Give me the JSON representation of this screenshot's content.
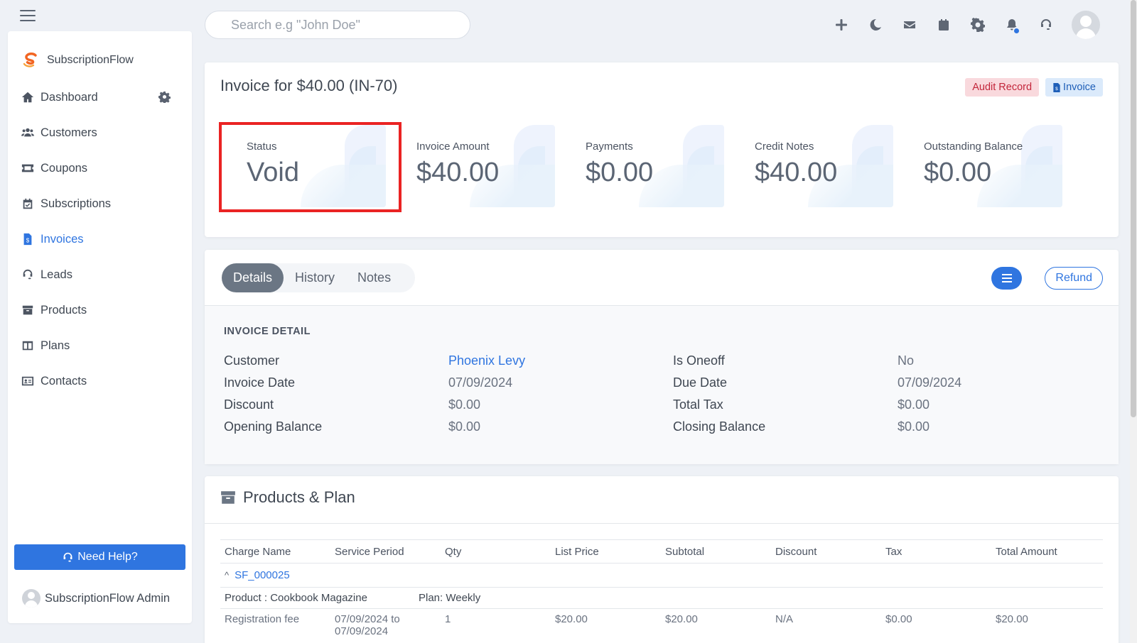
{
  "search": {
    "placeholder": "Search e.g \"John Doe\""
  },
  "top_icons": [
    "plus-icon",
    "moon-icon",
    "envelope-icon",
    "calendar-icon",
    "gear-icon",
    "bell-icon",
    "headset-icon"
  ],
  "brand": {
    "name": "SubscriptionFlow"
  },
  "sidebar": {
    "items": [
      {
        "label": "Dashboard",
        "icon": "home-icon"
      },
      {
        "label": "Customers",
        "icon": "users-icon"
      },
      {
        "label": "Coupons",
        "icon": "ticket-icon"
      },
      {
        "label": "Subscriptions",
        "icon": "calendar-check-icon"
      },
      {
        "label": "Invoices",
        "icon": "invoice-icon",
        "active": true
      },
      {
        "label": "Leads",
        "icon": "headset-icon"
      },
      {
        "label": "Products",
        "icon": "archive-icon"
      },
      {
        "label": "Plans",
        "icon": "columns-icon"
      },
      {
        "label": "Contacts",
        "icon": "address-card-icon"
      }
    ],
    "help_label": "Need Help?",
    "admin_name": "SubscriptionFlow Admin"
  },
  "invoice": {
    "title": "Invoice for $40.00 (IN-70)",
    "badge_audit": "Audit Record",
    "badge_invoice": "Invoice"
  },
  "stats": [
    {
      "label": "Status",
      "value": "Void"
    },
    {
      "label": "Invoice Amount",
      "value": "$40.00"
    },
    {
      "label": "Payments",
      "value": "$0.00"
    },
    {
      "label": "Credit Notes",
      "value": "$40.00"
    },
    {
      "label": "Outstanding Balance",
      "value": "$0.00"
    }
  ],
  "tabs": [
    "Details",
    "History",
    "Notes"
  ],
  "refund_label": "Refund",
  "detail": {
    "heading": "INVOICE DETAIL",
    "rows": [
      {
        "l1": "Customer",
        "v1": "Phoenix Levy",
        "l2": "Is Oneoff",
        "v2": "No"
      },
      {
        "l1": "Invoice Date",
        "v1": "07/09/2024",
        "l2": "Due Date",
        "v2": "07/09/2024"
      },
      {
        "l1": "Discount",
        "v1": "$0.00",
        "l2": "Total Tax",
        "v2": "$0.00"
      },
      {
        "l1": "Opening Balance",
        "v1": "$0.00",
        "l2": "Closing Balance",
        "v2": "$0.00"
      }
    ]
  },
  "products": {
    "title": "Products & Plan",
    "columns": [
      "Charge Name",
      "Service Period",
      "Qty",
      "List Price",
      "Subtotal",
      "Discount",
      "Tax",
      "Total Amount"
    ],
    "subscription": "SF_000025",
    "product_label": "Product : Cookbook Magazine",
    "plan_label": "Plan: Weekly",
    "line": {
      "charge": "Registration fee",
      "period_1": "07/09/2024 to",
      "period_2": "07/09/2024",
      "qty": "1",
      "list_price": "$20.00",
      "subtotal": "$20.00",
      "discount": "N/A",
      "tax": "$0.00",
      "total": "$20.00"
    }
  },
  "colors": {
    "accent": "#2f75e0",
    "highlight": "#ea2323"
  }
}
